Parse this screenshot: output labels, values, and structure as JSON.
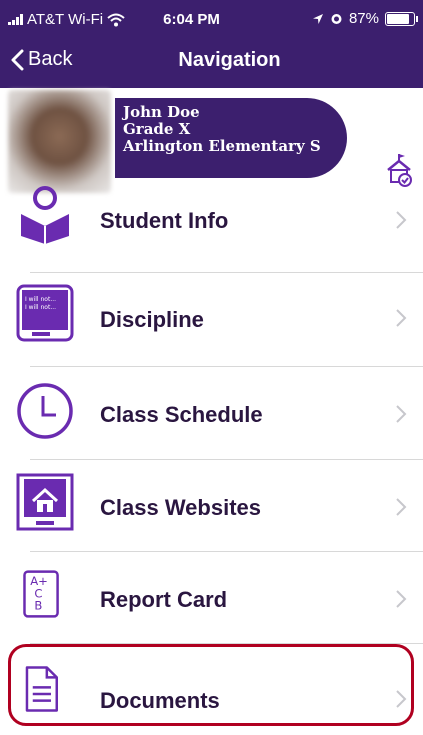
{
  "status_bar": {
    "carrier": "AT&T Wi-Fi",
    "time": "6:04 PM",
    "battery": "87%",
    "battery_level": 0.87
  },
  "nav": {
    "back_label": "Back",
    "title": "Navigation"
  },
  "student": {
    "name": "John Doe",
    "grade": "Grade X",
    "school": "Arlington Elementary S"
  },
  "menu": {
    "items": [
      {
        "label": "Student Info",
        "icon": "student-reading-icon"
      },
      {
        "label": "Discipline",
        "icon": "chalkboard-icon"
      },
      {
        "label": "Class Schedule",
        "icon": "clock-icon"
      },
      {
        "label": "Class Websites",
        "icon": "website-home-icon"
      },
      {
        "label": "Report Card",
        "icon": "report-card-grades-icon"
      },
      {
        "label": "Documents",
        "icon": "document-icon"
      }
    ],
    "discipline_icon_text": "I will not... I will not..."
  },
  "colors": {
    "header": "#3c1f6e",
    "accent": "#6a2bb0",
    "highlight": "#b00020"
  }
}
